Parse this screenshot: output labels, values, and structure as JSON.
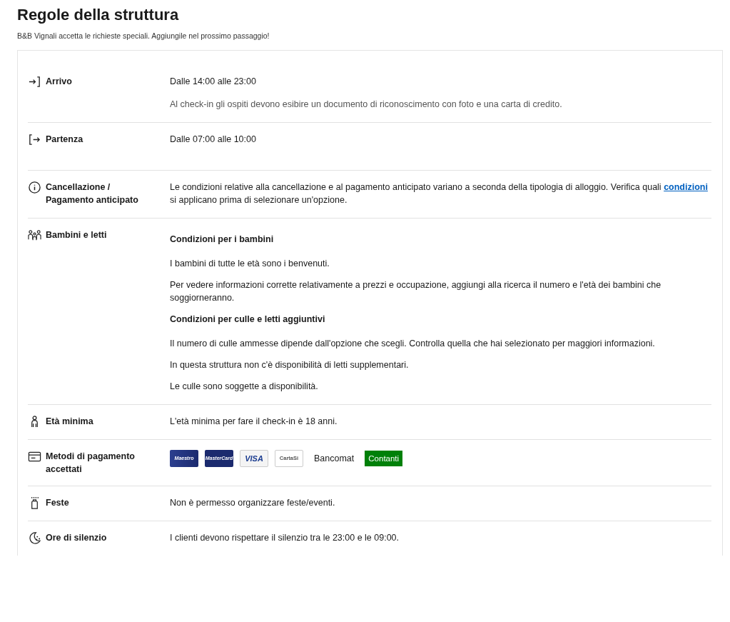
{
  "title": "Regole della struttura",
  "subtitle": "B&B Vignali accetta le richieste speciali. Aggiungile nel prossimo passaggio!",
  "rules": [
    {
      "kind": "arrive",
      "label": "Arrivo",
      "paragraphs": [
        {
          "kind": "text",
          "parts": [
            {
              "text": "Dalle 14:00 alle 23:00"
            }
          ]
        },
        {
          "kind": "muted",
          "parts": [
            {
              "text": "Al check-in gli ospiti devono esibire un documento di riconoscimento con foto e una carta di credito."
            }
          ]
        }
      ]
    },
    {
      "kind": "depart",
      "label": "Partenza",
      "paragraphs": [
        {
          "kind": "text",
          "parts": [
            {
              "text": "Dalle 07:00 alle 10:00"
            }
          ]
        }
      ]
    },
    {
      "kind": "info",
      "label": "Cancellazione / Pagamento anticipato",
      "paragraphs": [
        {
          "kind": "text",
          "parts": [
            {
              "text": "Le condizioni relative alla cancellazione e al pagamento anticipato variano a seconda della tipologia di alloggio. Verifica quali "
            },
            {
              "text": "condizioni",
              "link": true
            },
            {
              "text": " si applicano prima di selezionare un'opzione."
            }
          ]
        }
      ]
    },
    {
      "kind": "family",
      "label": "Bambini e letti",
      "paragraphs": [
        {
          "kind": "heading",
          "parts": [
            {
              "text": "Condizioni per i bambini"
            }
          ]
        },
        {
          "kind": "text",
          "parts": [
            {
              "text": "I bambini di tutte le età sono i benvenuti."
            }
          ]
        },
        {
          "kind": "text",
          "parts": [
            {
              "text": "Per vedere informazioni corrette relativamente a prezzi e occupazione, aggiungi alla ricerca il numero e l'età dei bambini che soggiorneranno."
            }
          ]
        },
        {
          "kind": "heading",
          "parts": [
            {
              "text": "Condizioni per culle e letti aggiuntivi"
            }
          ]
        },
        {
          "kind": "text",
          "parts": [
            {
              "text": "Il numero di culle ammesse dipende dall'opzione che scegli. Controlla quella che hai selezionato per maggiori informazioni."
            }
          ]
        },
        {
          "kind": "text",
          "parts": [
            {
              "text": "In questa struttura non c'è disponibilità di letti supplementari."
            }
          ]
        },
        {
          "kind": "text",
          "parts": [
            {
              "text": "Le culle sono soggette a disponibilità."
            }
          ]
        }
      ]
    },
    {
      "kind": "person",
      "label": "Età minima",
      "paragraphs": [
        {
          "kind": "text",
          "parts": [
            {
              "text": "L'età minima per fare il check-in è 18 anni."
            }
          ]
        }
      ]
    },
    {
      "kind": "card",
      "label": "Metodi di pagamento accettati",
      "payments": [
        {
          "kind": "maestro",
          "text": "Maestro"
        },
        {
          "kind": "mastercard",
          "text": "MasterCard"
        },
        {
          "kind": "visa",
          "text": "VISA"
        },
        {
          "kind": "cartasi",
          "text": "CartaSi"
        },
        {
          "kind": "plain",
          "text": "Bancomat"
        },
        {
          "kind": "cash",
          "text": "Contanti"
        }
      ]
    },
    {
      "kind": "party",
      "label": "Feste",
      "paragraphs": [
        {
          "kind": "text",
          "parts": [
            {
              "text": "Non è permesso organizzare feste/eventi."
            }
          ]
        }
      ]
    },
    {
      "kind": "moon",
      "label": "Ore di silenzio",
      "paragraphs": [
        {
          "kind": "text",
          "parts": [
            {
              "text": "I clienti devono rispettare il silenzio tra le 23:00 e le 09:00."
            }
          ]
        }
      ]
    }
  ]
}
